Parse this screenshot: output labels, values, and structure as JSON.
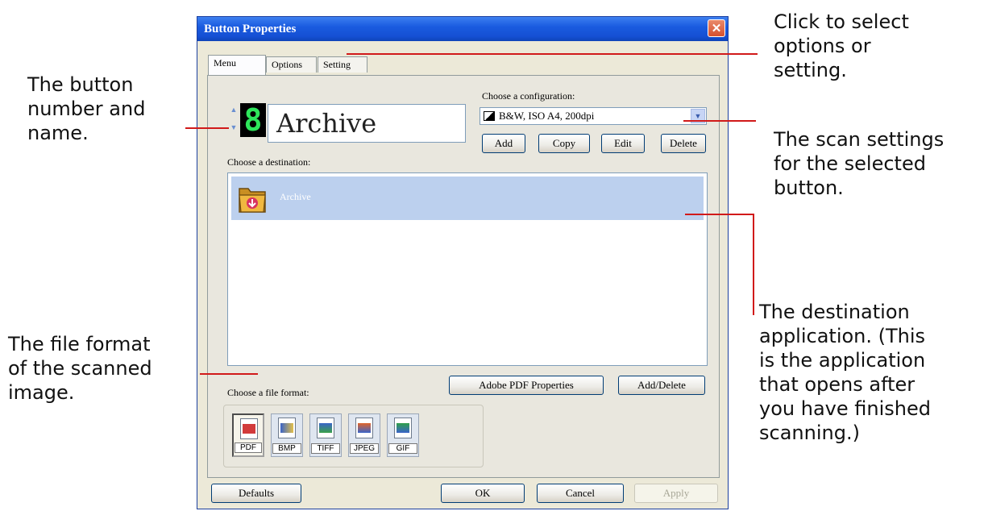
{
  "dialog": {
    "title": "Button Properties",
    "close_glyph": "✕",
    "tabs": [
      {
        "label": "Menu",
        "active": true
      },
      {
        "label": "Options",
        "active": false
      },
      {
        "label": "Setting",
        "active": false
      }
    ],
    "button_number": "8",
    "button_name": "Archive",
    "configuration": {
      "label": "Choose a configuration:",
      "value": "B&W, ISO A4, 200dpi",
      "buttons": {
        "add": "Add",
        "copy": "Copy",
        "edit": "Edit",
        "delete": "Delete"
      }
    },
    "destination": {
      "label": "Choose a destination:",
      "items": [
        {
          "label": "Archive",
          "icon": "folder-archive-icon",
          "selected": true
        }
      ]
    },
    "file_format": {
      "label": "Choose a file format:",
      "formats": [
        {
          "label": "PDF",
          "icon": "pdf-icon",
          "selected": true
        },
        {
          "label": "BMP",
          "icon": "bmp-icon",
          "selected": false
        },
        {
          "label": "TIFF",
          "icon": "tiff-icon",
          "selected": false
        },
        {
          "label": "JPEG",
          "icon": "jpeg-icon",
          "selected": false
        },
        {
          "label": "GIF",
          "icon": "gif-icon",
          "selected": false
        }
      ]
    },
    "buttons": {
      "pdf_properties": "Adobe PDF Properties",
      "add_delete": "Add/Delete",
      "defaults": "Defaults",
      "ok": "OK",
      "cancel": "Cancel",
      "apply": "Apply"
    }
  },
  "callouts": {
    "tabs": [
      "Click to select",
      "options or",
      "setting."
    ],
    "button_name": [
      "The button",
      "number and",
      "name."
    ],
    "scan_settings": [
      "The scan settings",
      "for the selected",
      "button."
    ],
    "file_format": [
      "The file format",
      "of the scanned",
      "image."
    ],
    "destination": [
      "The destination",
      "application. (This",
      "is the application",
      "that opens after",
      "you have finished",
      "scanning.)"
    ]
  },
  "colors": {
    "title_bar": "#1a5be0",
    "leader_line": "#d11a1a",
    "selection": "#bcd0ee",
    "digit": "#2ee65b"
  }
}
